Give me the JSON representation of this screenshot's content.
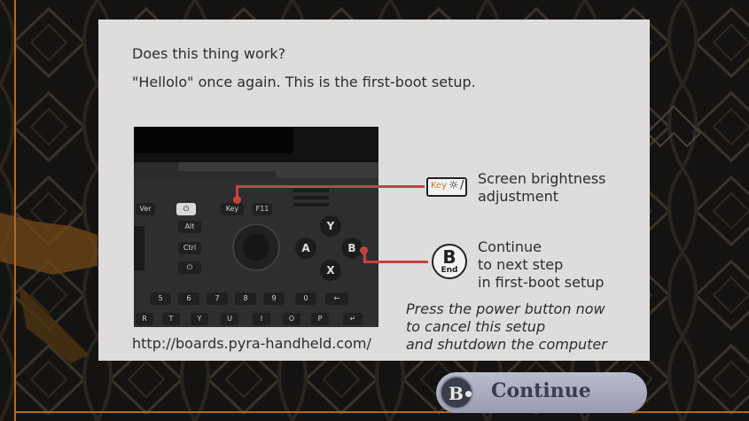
{
  "panel": {
    "question": "Does this thing work?",
    "hello_line": "\"Hellolo\" once again. This is the first-boot setup.",
    "url": "http://boards.pyra-handheld.com/"
  },
  "hints": {
    "brightness": [
      "Screen brightness",
      "adjustment"
    ],
    "continue_hint": [
      "Continue",
      "to next step",
      "in first-boot setup"
    ],
    "power_note": [
      "Press the power button now",
      "to cancel this setup",
      "and shutdown the computer"
    ],
    "key_icon_text": "Key"
  },
  "button_icon": {
    "letter": "B",
    "sub": "End"
  },
  "continue_button": {
    "label": "Continue",
    "letter": "B"
  },
  "device_keys": {
    "row1": [
      "Ver",
      "⏻",
      "Key",
      "F11"
    ],
    "left": [
      "Alt",
      "Ctrl",
      "⏻"
    ],
    "num_row": [
      "5",
      "6",
      "7",
      "8",
      "9",
      "0",
      "←"
    ],
    "letter_row": [
      "R",
      "T",
      "Y",
      "U",
      "I",
      "O",
      "P",
      "↵"
    ],
    "face": [
      "Y",
      "A",
      "B",
      "X"
    ]
  },
  "colors": {
    "accent": "#c8413f",
    "panel": "#dedcdc",
    "button": "#b9bccc",
    "frame": "#b06a28"
  }
}
